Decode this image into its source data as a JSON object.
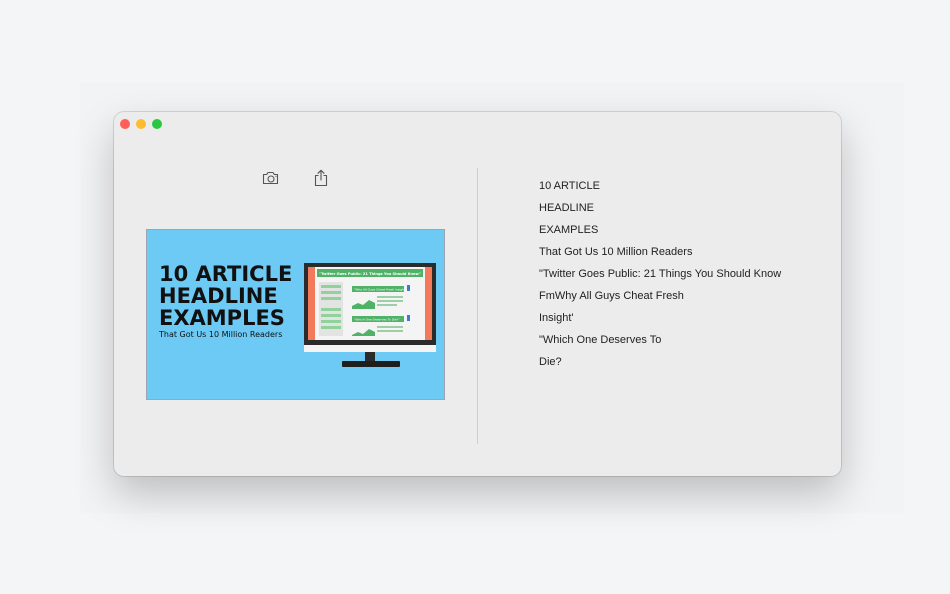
{
  "window": {
    "controls": {
      "close_color": "#ff5f57",
      "minimize_color": "#febc2e",
      "zoom_color": "#28c840"
    },
    "toolbar": {
      "camera_icon": "camera-icon",
      "share_icon": "share-icon"
    }
  },
  "image": {
    "background": "#6ccaf5",
    "headline_lines": [
      "10 ARTICLE",
      "HEADLINE",
      "EXAMPLES"
    ],
    "subline": "That Got Us 10 Million Readers",
    "monitor_banner": "\"Twitter Goes Public: 21 Things You Should Know\"",
    "panel_label_1": "\"Why All Guys Cheat Fresh Insight\"",
    "panel_label_2": "\"Which One Deserves To Die?\""
  },
  "recognized_text": {
    "lines": [
      "10 ARTICLE",
      "HEADLINE",
      "EXAMPLES",
      "That Got Us 10 Million Readers",
      "\"Twitter Goes Public: 21 Things You Should Know",
      "FmWhy All Guys Cheat Fresh",
      "Insight'",
      "\"Which One Deserves To",
      "Die?"
    ]
  }
}
